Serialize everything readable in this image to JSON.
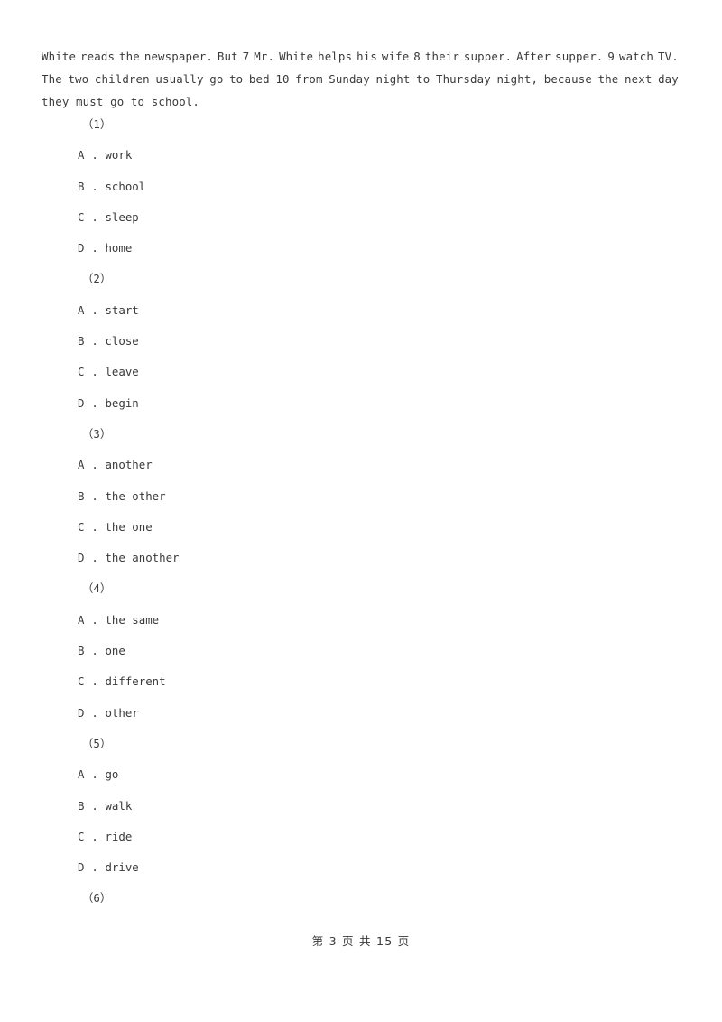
{
  "document": {
    "passage": {
      "lines": [
        "White reads the newspaper. But 7 Mr. White helps his wife 8 their supper. After supper. 9 watch TV.",
        "The two children usually go to bed 10 from Sunday night to Thursday night, because the next day",
        "they must go to school."
      ],
      "line1_words": [
        "White",
        "reads",
        "the",
        "newspaper.",
        "But",
        "7",
        "Mr.",
        "White",
        "helps",
        "his",
        "wife",
        "8",
        "their",
        "supper.",
        "After",
        "supper.",
        "9",
        "watch",
        "TV."
      ],
      "line2_words": [
        "The",
        "two",
        "children",
        "usually",
        "go",
        "to",
        "bed",
        "10",
        "from",
        "Sunday",
        "night",
        "to",
        "Thursday",
        "night,",
        "because",
        "the",
        "next",
        "day"
      ],
      "line3_text": "they must go to school."
    },
    "questions": [
      {
        "number": "（1）",
        "options": [
          {
            "label": "A .",
            "text": "work"
          },
          {
            "label": "B .",
            "text": "school"
          },
          {
            "label": "C .",
            "text": "sleep"
          },
          {
            "label": "D .",
            "text": "home"
          }
        ]
      },
      {
        "number": "（2）",
        "options": [
          {
            "label": "A .",
            "text": "start"
          },
          {
            "label": "B .",
            "text": "close"
          },
          {
            "label": "C .",
            "text": "leave"
          },
          {
            "label": "D .",
            "text": "begin"
          }
        ]
      },
      {
        "number": "（3）",
        "options": [
          {
            "label": "A .",
            "text": "another"
          },
          {
            "label": "B .",
            "text": "the other"
          },
          {
            "label": "C .",
            "text": "the one"
          },
          {
            "label": "D .",
            "text": "the another"
          }
        ]
      },
      {
        "number": "（4）",
        "options": [
          {
            "label": "A .",
            "text": "the same"
          },
          {
            "label": "B .",
            "text": "one"
          },
          {
            "label": "C .",
            "text": "different"
          },
          {
            "label": "D .",
            "text": "other"
          }
        ]
      },
      {
        "number": "（5）",
        "options": [
          {
            "label": "A .",
            "text": "go"
          },
          {
            "label": "B .",
            "text": "walk"
          },
          {
            "label": "C .",
            "text": "ride"
          },
          {
            "label": "D .",
            "text": "drive"
          }
        ]
      },
      {
        "number": "（6）",
        "options": []
      }
    ],
    "footer": {
      "text": "第 3 页 共 15 页",
      "current_page": "3",
      "total_pages": "15"
    }
  }
}
